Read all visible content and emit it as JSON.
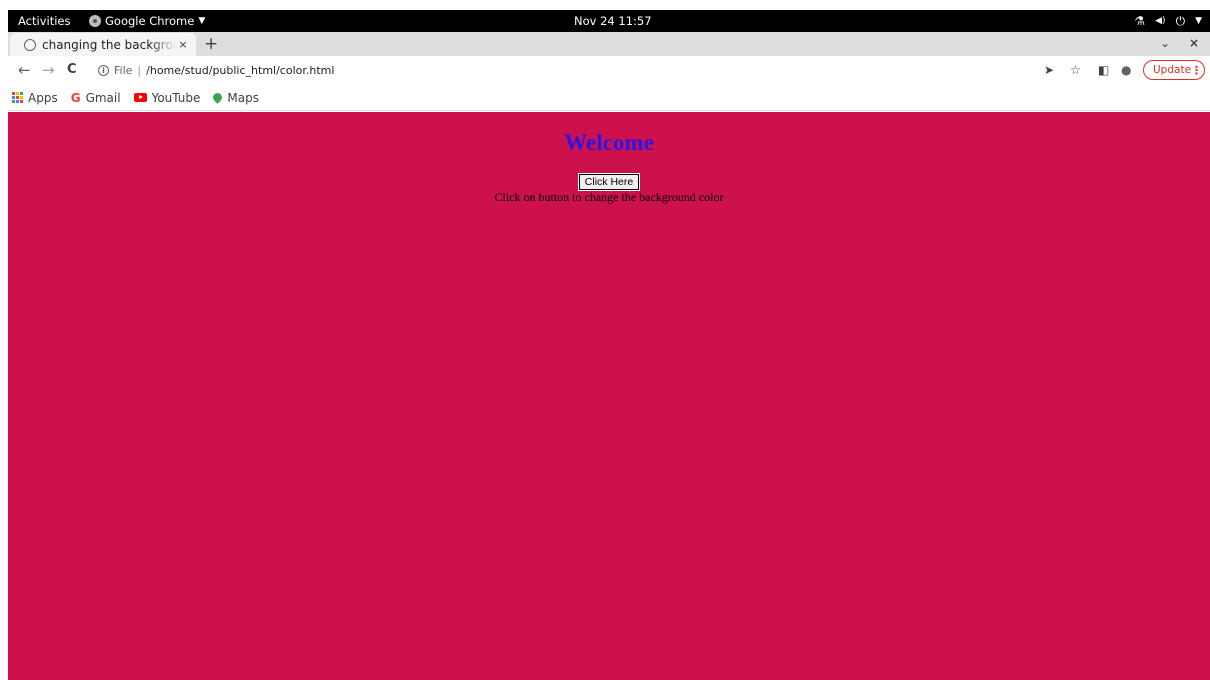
{
  "colors": {
    "page_background": "#cc114c",
    "heading": "#2a14e6"
  },
  "os_bar": {
    "activities": "Activities",
    "app_name": "Google Chrome",
    "app_menu_arrow": "▼",
    "clock": "Nov 24  11:57",
    "tray": {
      "network": "⚗",
      "volume": "◀)",
      "power": "⏻",
      "menu_arrow": "▼"
    }
  },
  "browser": {
    "tab": {
      "title": "changing the background color",
      "close": "×"
    },
    "new_tab": "+",
    "tab_search": "⌄",
    "window_close": "×",
    "nav": {
      "back": "←",
      "forward": "→",
      "reload": "C"
    },
    "address": {
      "info": "i",
      "scheme": "File",
      "separator": "|",
      "path": "/home/stud/public_html/color.html"
    },
    "toolbar_icons": {
      "send": "➤",
      "star": "☆",
      "side_panel": "◧",
      "profile": "●"
    },
    "update": {
      "label": "Update",
      "menu": "⋮"
    },
    "bookmarks": [
      {
        "label": "Apps"
      },
      {
        "label": "Gmail"
      },
      {
        "label": "YouTube"
      },
      {
        "label": "Maps"
      }
    ]
  },
  "page": {
    "heading": "Welcome",
    "button_label": "Click Here",
    "hint": "Click on button to change the background color"
  }
}
